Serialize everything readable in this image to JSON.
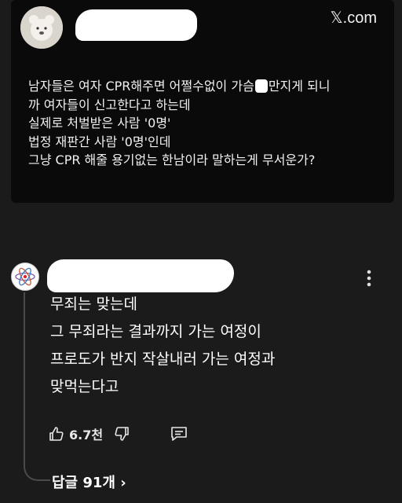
{
  "post": {
    "source": "𝕏.com",
    "lines": [
      {
        "before": "남자들은 여자 CPR해주면 어쩔수없이 가슴",
        "after": "만지게 되니"
      },
      {
        "text": "까 여자들이 신고한다고 하는데"
      },
      {
        "text": "실제로 처벌받은 사람 '0명'"
      },
      {
        "text": "법정 재판간 사람 '0명'인데"
      },
      {
        "text": "그냥 CPR 해줄 용기없는 한남이라 말하는게 무서운가?"
      }
    ]
  },
  "comment": {
    "lines": [
      "무죄는 맞는데",
      "그 무죄라는 결과까지 가는 여정이",
      "프로도가 반지 작살내러 가는 여정과",
      "맞먹는다고"
    ],
    "like_count": "6.7천",
    "replies_label": "답글 91개 ›"
  },
  "colors": {
    "background": "#1b1b1b",
    "post_bg": "#0a0a0a",
    "text": "#ffffff"
  },
  "icons": [
    "x-logo-icon",
    "more-vertical-icon",
    "thumbs-up-icon",
    "thumbs-down-icon",
    "reply-comment-icon"
  ]
}
